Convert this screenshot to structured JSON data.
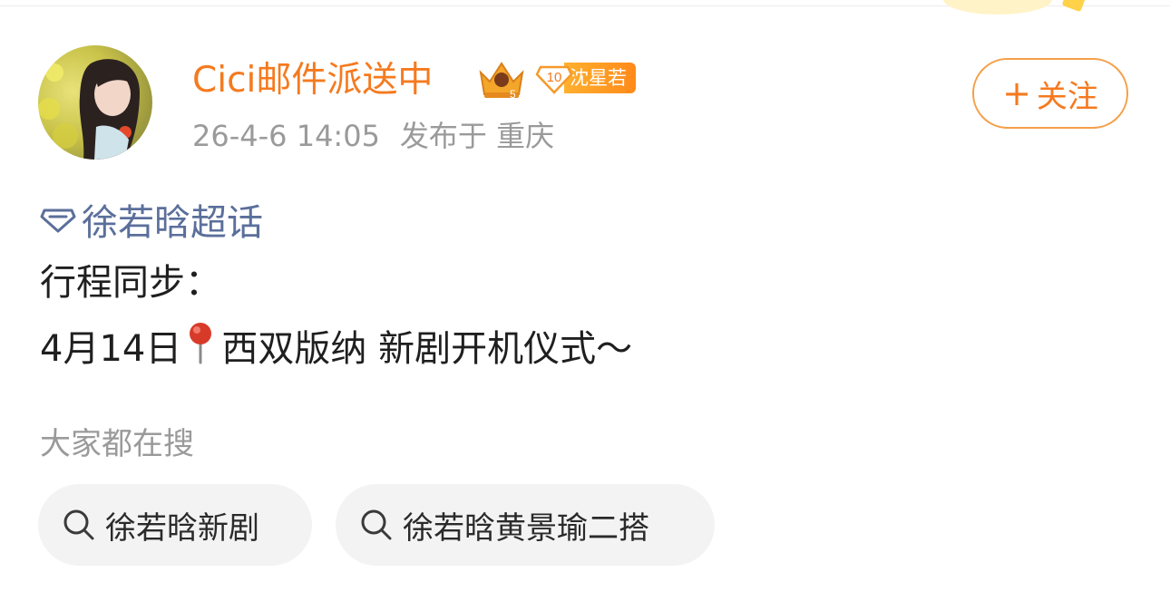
{
  "post": {
    "user_name": "Cici邮件派送中",
    "crown_icon": "crown-badge-icon",
    "fan_badge": {
      "level": "10",
      "label": "沈星若"
    },
    "timestamp": "26-4-6 14:05",
    "location": "发布于 重庆",
    "follow": {
      "plus": "+",
      "label": "关注"
    },
    "topic": "徐若晗超话",
    "content_line1": "行程同步：",
    "content_line2_date": "4月14日",
    "content_line2_pin": "📍",
    "content_line2_text": "西双版纳 新剧开机仪式～"
  },
  "search": {
    "title": "大家都在搜",
    "chips": [
      {
        "label": "徐若晗新剧",
        "icon": "search-icon"
      },
      {
        "label": "徐若晗黄景瑜二搭",
        "icon": "search-icon"
      }
    ]
  },
  "colors": {
    "accent": "#f57a1f",
    "topic_link": "#5b6f9b",
    "muted_text": "#9a9a9a",
    "chip_bg": "#f3f3f3",
    "badge_gradient_start": "#ffb02e",
    "badge_gradient_end": "#ff8a1a"
  }
}
